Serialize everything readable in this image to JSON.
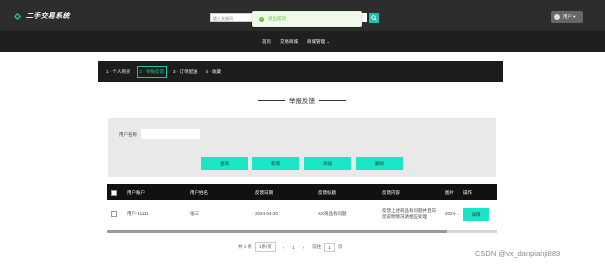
{
  "app": {
    "title": "二手交易系统"
  },
  "search": {
    "placeholder": "输入关键词"
  },
  "toast": {
    "message": "退出成功"
  },
  "user": {
    "label": "用户 ▾"
  },
  "nav": {
    "items": [
      "首页",
      "交易商城",
      "商城管理 ⌄"
    ]
  },
  "steps": [
    {
      "label": "1 · 个人购买"
    },
    {
      "label": "2 · 举报反馈"
    },
    {
      "label": "3 · 订单配送"
    },
    {
      "label": "4 · 收藏"
    }
  ],
  "section": {
    "title": "举报反馈"
  },
  "filter": {
    "label": "用户名称",
    "value": "",
    "buttons": [
      "查询",
      "新增",
      "添加",
      "删除"
    ]
  },
  "table": {
    "headers": [
      "",
      "用户账户",
      "用户姓名",
      "反馈日期",
      "反馈标题",
      "反馈内容",
      "图片",
      "操作"
    ],
    "rows": [
      {
        "account": "用户-11111",
        "name": "张三",
        "date": "2024-04-20",
        "title": "XX商品有问题",
        "content": "反馈上述商品有问题并且向您说明情况请相应处理",
        "image": "2024-...",
        "action": "详情"
      }
    ]
  },
  "pagination": {
    "total": "共 1 条",
    "page_size": "1条/页",
    "prev": "‹",
    "current": "1",
    "next": "›",
    "goto_label": "前往",
    "goto_value": "1",
    "page_unit": "页"
  },
  "watermark": "CSDN @vx_danpianji889",
  "colors": {
    "accent": "#19e6c4",
    "dark": "#1f1f1f"
  }
}
